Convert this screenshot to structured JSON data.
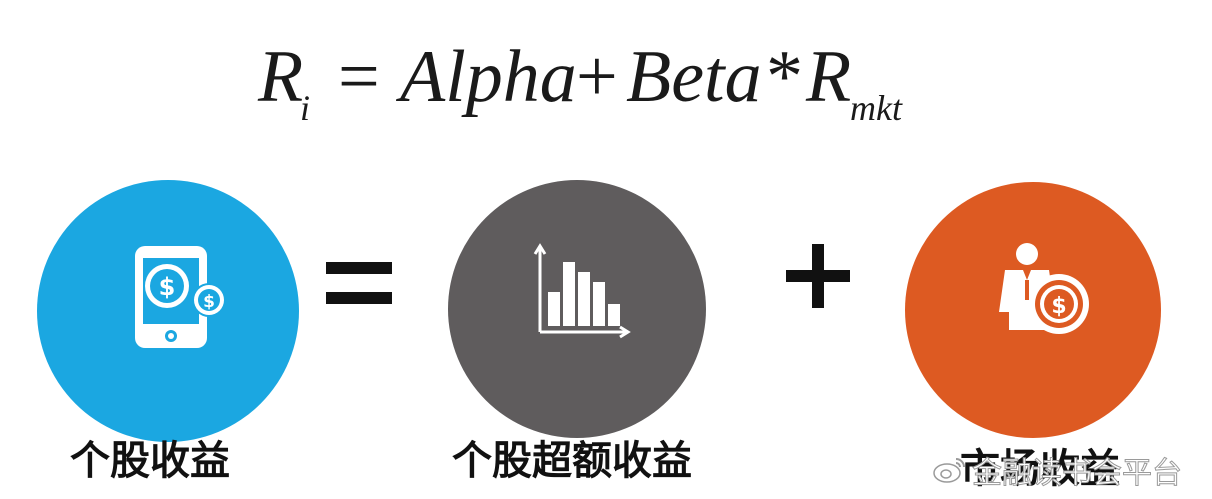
{
  "formula": {
    "lhs": "R",
    "lhs_sub": "i",
    "eq": "=",
    "alpha": "Alpha",
    "plus": "+",
    "beta": "Beta",
    "star": "*",
    "rm": "R",
    "rm_sub": "mkt"
  },
  "terms": [
    {
      "label": "个股收益",
      "icon": "phone-dollar-icon",
      "color": "#1ba7e1"
    },
    {
      "label": "个股超额收益",
      "icon": "bar-chart-icon",
      "color": "#5f5c5d"
    },
    {
      "label": "市场收益",
      "icon": "businessman-coin-icon",
      "color": "#dd5a22"
    }
  ],
  "operators": [
    "=",
    "+"
  ],
  "watermark": {
    "text": "金融读书会平台",
    "icon": "weibo-icon"
  }
}
